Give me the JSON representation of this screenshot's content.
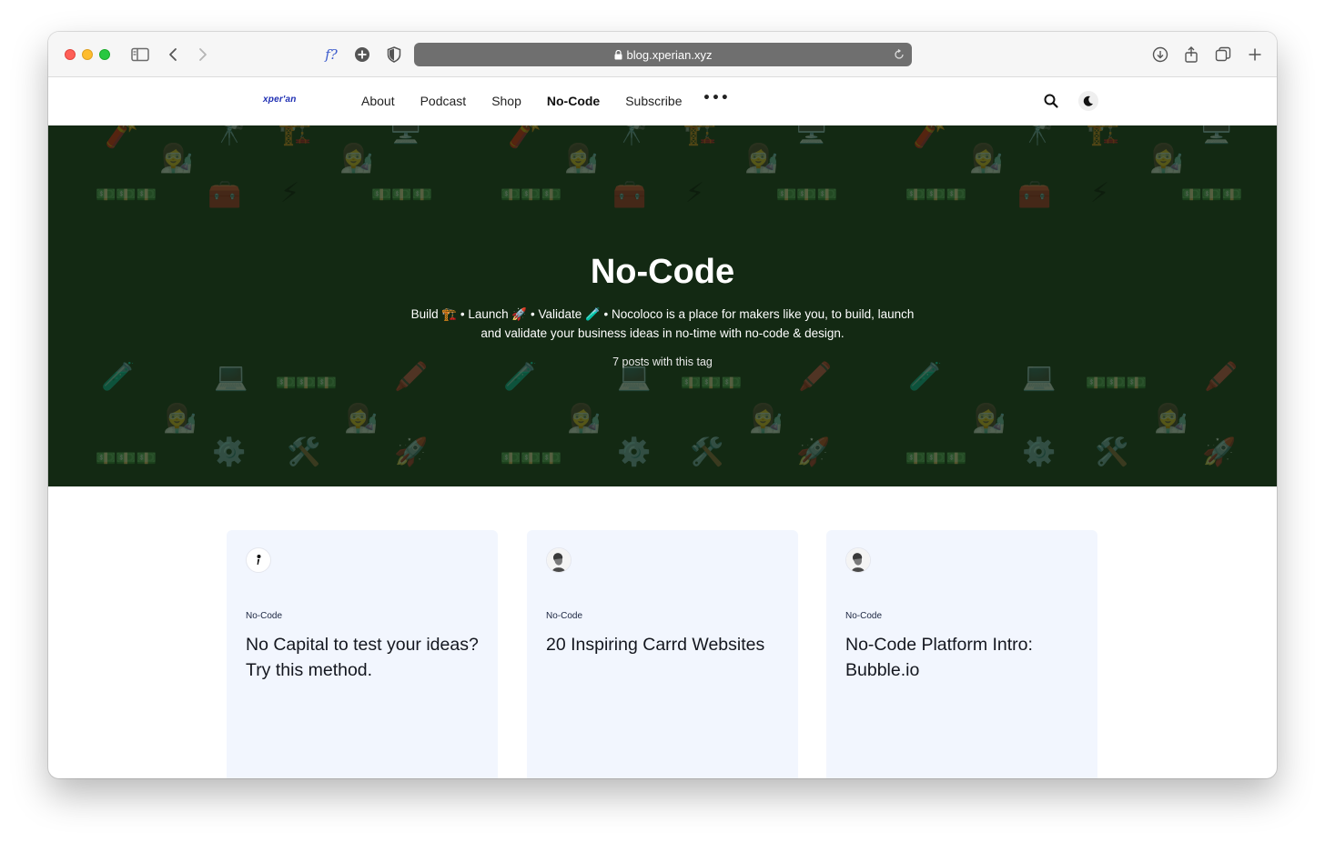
{
  "browser": {
    "url": "blog.xperian.xyz",
    "extension_label": "f?"
  },
  "site": {
    "logo": "xper'an",
    "nav": [
      {
        "label": "About",
        "active": false
      },
      {
        "label": "Podcast",
        "active": false
      },
      {
        "label": "Shop",
        "active": false
      },
      {
        "label": "No-Code",
        "active": true
      },
      {
        "label": "Subscribe",
        "active": false
      }
    ],
    "more_label": "•••"
  },
  "hero": {
    "title": "No-Code",
    "description_line1": "Build 🏗️ • Launch 🚀 • Validate 🧪 • Nocoloco is a place for makers like you, to build, launch",
    "description_line2": "and validate your business ideas in no-time with no-code & design.",
    "post_count": "7 posts with this tag",
    "background_color": "#132913"
  },
  "cards": [
    {
      "tag": "No-Code",
      "title": "No Capital to test your ideas? Try this method.",
      "avatar": "logo-mark"
    },
    {
      "tag": "No-Code",
      "title": "20 Inspiring Carrd Websites",
      "avatar": "author-photo"
    },
    {
      "tag": "No-Code",
      "title": "No-Code Platform Intro: Bubble.io",
      "avatar": "author-photo"
    }
  ],
  "colors": {
    "card_bg": "#f2f6fe",
    "logo": "#1f2fb3"
  }
}
